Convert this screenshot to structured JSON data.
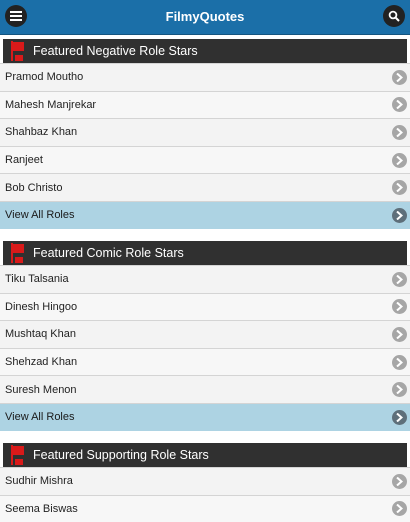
{
  "app": {
    "title": "FilmyQuotes"
  },
  "icons": {
    "menu": "menu-icon",
    "search": "search-icon",
    "flag": "award-flag-icon",
    "chevron": "chevron-right-icon"
  },
  "colors": {
    "topbar": "#1b6fa8",
    "header": "#303030",
    "view_all": "#add3e3",
    "flag": "#d91a1a"
  },
  "sections": [
    {
      "title": "Featured Negative Role Stars",
      "items": [
        "Pramod Moutho",
        "Mahesh Manjrekar",
        "Shahbaz Khan",
        "Ranjeet",
        "Bob Christo"
      ],
      "view_all": "View All Roles"
    },
    {
      "title": "Featured Comic Role Stars",
      "items": [
        "Tiku Talsania",
        "Dinesh Hingoo",
        "Mushtaq Khan",
        "Shehzad Khan",
        "Suresh Menon"
      ],
      "view_all": "View All Roles"
    },
    {
      "title": "Featured Supporting Role Stars",
      "items": [
        "Sudhir Mishra",
        "Seema Biswas"
      ]
    }
  ]
}
